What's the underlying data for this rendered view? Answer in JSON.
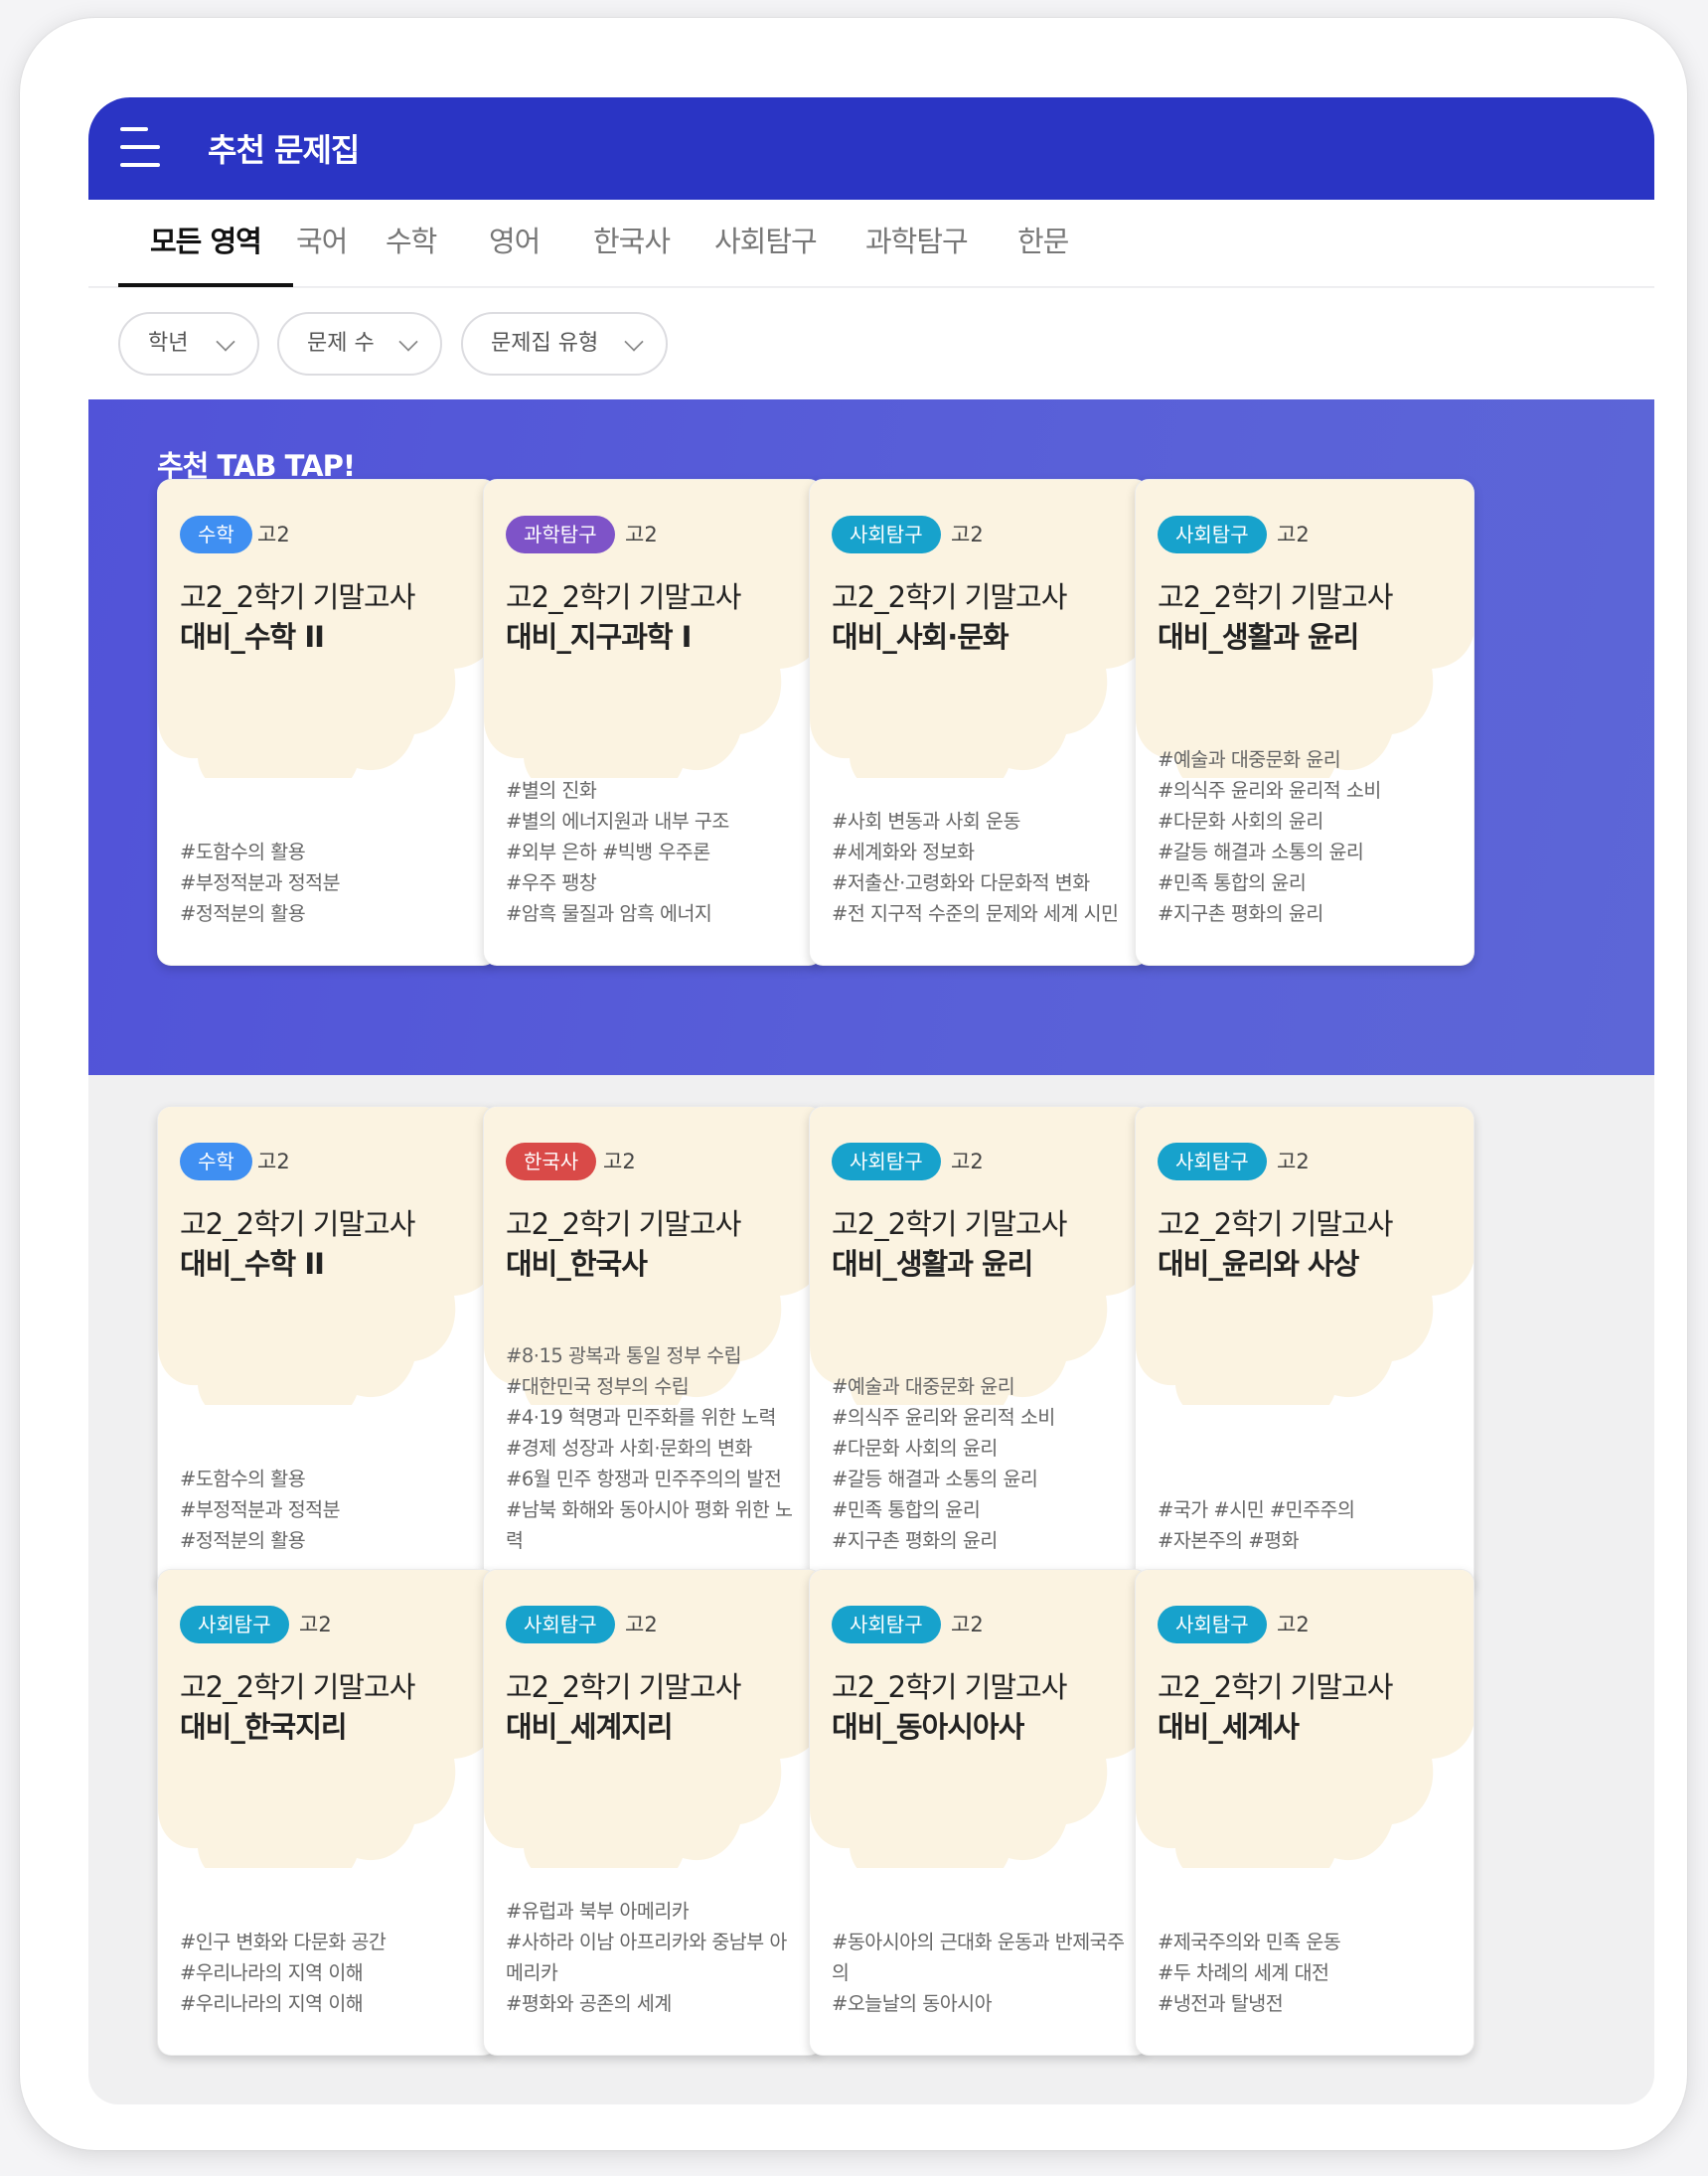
{
  "header": {
    "title": "추천 문제집"
  },
  "tabs": [
    "모든 영역",
    "국어",
    "수학",
    "영어",
    "한국사",
    "사회탐구",
    "과학탐구",
    "한문"
  ],
  "filters": [
    "학년",
    "문제 수",
    "문제집 유형"
  ],
  "hero": {
    "title": "추천 TAB TAP!"
  },
  "colors": {
    "appbar": "#2a34c4",
    "hero": "#5558d8",
    "badge_math": "#3f8ff2",
    "badge_science": "#7e53c8",
    "badge_social": "#17a2cc",
    "badge_history": "#d94a48",
    "cloud": "#fbf3e1"
  },
  "recommended": [
    {
      "subject": "수학",
      "grade": "고2",
      "title_line1": "고2_2학기 기말고사",
      "title_line2": "대비_수학 II",
      "tags": [
        "#도함수의 활용",
        "#부정적분과 정적분",
        "#정적분의 활용"
      ]
    },
    {
      "subject": "과학탐구",
      "grade": "고2",
      "title_line1": "고2_2학기 기말고사",
      "title_line2": "대비_지구과학 I",
      "tags": [
        "#별의 진화",
        "#별의 에너지원과 내부 구조",
        "#외부 은하 #빅뱅 우주론",
        "#우주 팽창",
        "#암흑 물질과 암흑 에너지"
      ]
    },
    {
      "subject": "사회탐구",
      "grade": "고2",
      "title_line1": "고2_2학기 기말고사",
      "title_line2": "대비_사회·문화",
      "tags": [
        "#사회 변동과 사회 운동",
        "#세계화와 정보화",
        "#저출산·고령화와 다문화적 변화",
        "#전 지구적 수준의 문제와 세계 시민"
      ]
    },
    {
      "subject": "사회탐구",
      "grade": "고2",
      "title_line1": "고2_2학기 기말고사",
      "title_line2": "대비_생활과 윤리",
      "tags": [
        "#예술과 대중문화 윤리",
        "#의식주 윤리와 윤리적 소비",
        "#다문화 사회의 윤리",
        "#갈등 해결과 소통의 윤리",
        "#민족 통합의 윤리",
        "#지구촌 평화의 윤리"
      ]
    }
  ],
  "list": [
    {
      "subject": "수학",
      "grade": "고2",
      "title_line1": "고2_2학기 기말고사",
      "title_line2": "대비_수학 II",
      "tags": [
        "#도함수의 활용",
        "#부정적분과 정적분",
        "#정적분의 활용"
      ]
    },
    {
      "subject": "한국사",
      "grade": "고2",
      "title_line1": "고2_2학기 기말고사",
      "title_line2": "대비_한국사",
      "tags": [
        "#8·15 광복과 통일 정부 수립",
        "#대한민국 정부의 수립",
        "#4·19 혁명과 민주화를 위한 노력",
        "#경제 성장과 사회·문화의 변화",
        "#6월 민주 항쟁과 민주주의의 발전",
        "#남북 화해와 동아시아 평화 위한 노력"
      ]
    },
    {
      "subject": "사회탐구",
      "grade": "고2",
      "title_line1": "고2_2학기 기말고사",
      "title_line2": "대비_생활과 윤리",
      "tags": [
        "#예술과 대중문화 윤리",
        "#의식주 윤리와 윤리적 소비",
        "#다문화 사회의 윤리",
        "#갈등 해결과 소통의 윤리",
        "#민족 통합의 윤리",
        "#지구촌 평화의 윤리"
      ]
    },
    {
      "subject": "사회탐구",
      "grade": "고2",
      "title_line1": "고2_2학기 기말고사",
      "title_line2": "대비_윤리와 사상",
      "tags": [
        "#국가 #시민 #민주주의",
        "#자본주의 #평화"
      ]
    },
    {
      "subject": "사회탐구",
      "grade": "고2",
      "title_line1": "고2_2학기 기말고사",
      "title_line2": "대비_한국지리",
      "tags": [
        "#인구 변화와 다문화 공간",
        "#우리나라의 지역 이해",
        "#우리나라의 지역 이해"
      ]
    },
    {
      "subject": "사회탐구",
      "grade": "고2",
      "title_line1": "고2_2학기 기말고사",
      "title_line2": "대비_세계지리",
      "tags": [
        "#유럽과 북부 아메리카",
        "#사하라 이남 아프리카와 중남부 아메리카",
        "#평화와 공존의 세계"
      ]
    },
    {
      "subject": "사회탐구",
      "grade": "고2",
      "title_line1": "고2_2학기 기말고사",
      "title_line2": "대비_동아시아사",
      "tags": [
        "#동아시아의 근대화 운동과 반제국주의",
        "#오늘날의 동아시아"
      ]
    },
    {
      "subject": "사회탐구",
      "grade": "고2",
      "title_line1": "고2_2학기 기말고사",
      "title_line2": "대비_세계사",
      "tags": [
        "#제국주의와 민족 운동",
        "#두 차례의 세계 대전",
        "#냉전과 탈냉전"
      ]
    }
  ]
}
